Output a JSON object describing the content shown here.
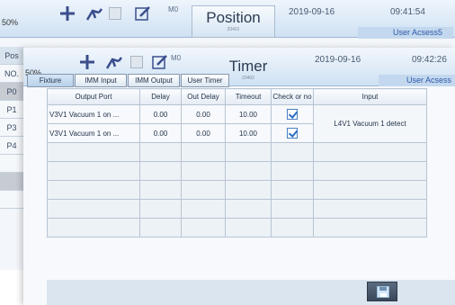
{
  "back_window": {
    "zoom": "50%",
    "mode": "M0",
    "title": "Position",
    "subtitle": "20401",
    "date": "2019-09-16",
    "time": "09:41:54",
    "user": "User Acsess5",
    "side_tabs": [
      "Pos",
      "NO.",
      "P0",
      "P1",
      "P3",
      "P4",
      "",
      "",
      ""
    ]
  },
  "front_window": {
    "zoom": "50%",
    "mode": "M0",
    "title": "Timer",
    "subtitle": "20402",
    "date": "2019-09-16",
    "time": "09:42:26",
    "user": "User Acsess",
    "tabs": [
      "Fixture",
      "IMM Input",
      "IMM Output",
      "User Timer"
    ],
    "table": {
      "headers": [
        "Output Port",
        "Delay",
        "Out Delay",
        "Timeout",
        "Check or no",
        "Input"
      ],
      "rows": [
        {
          "output": "V3V1 Vacuum 1 on ...",
          "delay": "0.00",
          "out_delay": "0.00",
          "timeout": "10.00",
          "check": true
        },
        {
          "output": "V3V1 Vacuum 1 on ...",
          "delay": "0.00",
          "out_delay": "0.00",
          "timeout": "10.00",
          "check": true
        }
      ],
      "input_value": "L4V1 Vacuum 1 detect"
    }
  },
  "colors": {
    "header_top": "#f2f7fd",
    "header_bottom": "#cfe1f3",
    "accent_text": "#2f58a8",
    "check": "#2a6cc0",
    "save_button": "#4a586c"
  }
}
